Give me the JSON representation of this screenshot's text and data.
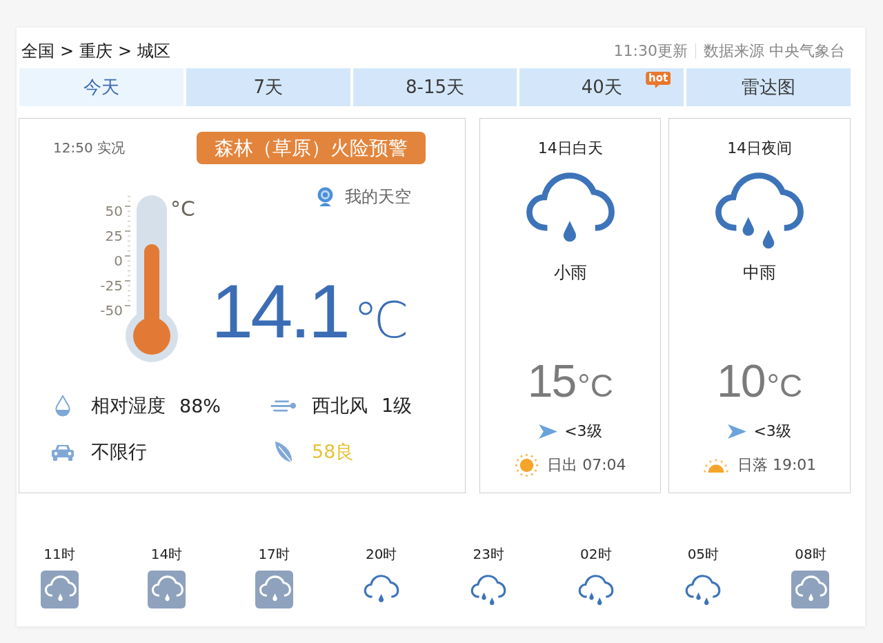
{
  "breadcrumb": {
    "items": [
      "全国",
      "重庆",
      "城区"
    ],
    "separator": ">"
  },
  "update_time": "11:30更新",
  "source": "数据来源 中央气象台",
  "tabs": [
    {
      "label": "今天",
      "selected": true
    },
    {
      "label": "7天",
      "selected": false
    },
    {
      "label": "8-15天",
      "selected": false
    },
    {
      "label": "40天",
      "selected": false,
      "badge": "hot"
    },
    {
      "label": "雷达图",
      "selected": false
    }
  ],
  "current": {
    "observed": "12:50 实况",
    "alert": "森林（草原）火险预警",
    "my_sky": "我的天空",
    "thermometer": {
      "scale": [
        "50",
        "25",
        "0",
        "-25",
        "-50"
      ],
      "unit": "°C",
      "level": 0.6
    },
    "temperature": "14.1",
    "unit": "℃",
    "stats": [
      {
        "kind": "humidity",
        "label": "相对湿度",
        "value": "88%"
      },
      {
        "kind": "wind",
        "label": "西北风",
        "value": "1级"
      },
      {
        "kind": "traffic",
        "label": "不限行"
      },
      {
        "kind": "aqi",
        "label": "58良",
        "color": "#e6c236"
      }
    ]
  },
  "forecast": [
    {
      "kind": "day",
      "title": "14日白天",
      "weather": "小雨",
      "temperature": "15",
      "unit": "°C",
      "wind": "<3级",
      "sun": "日出 07:04"
    },
    {
      "kind": "night",
      "title": "14日夜间",
      "weather": "中雨",
      "temperature": "10",
      "unit": "°C",
      "wind": "<3级",
      "sun": "日落 19:01"
    }
  ],
  "hourly": [
    {
      "time": "11时",
      "kind": "tile"
    },
    {
      "time": "14时",
      "kind": "tile"
    },
    {
      "time": "17时",
      "kind": "tile"
    },
    {
      "time": "20时",
      "kind": "light"
    },
    {
      "time": "23时",
      "kind": "moderate"
    },
    {
      "time": "02时",
      "kind": "moderate"
    },
    {
      "time": "05时",
      "kind": "moderate"
    },
    {
      "time": "08时",
      "kind": "tile"
    }
  ]
}
